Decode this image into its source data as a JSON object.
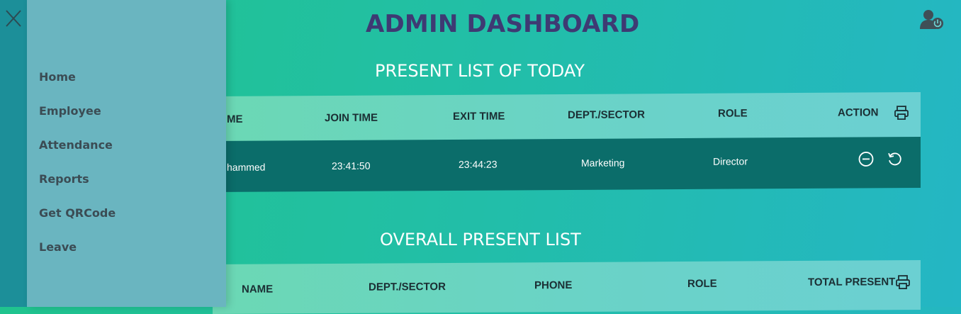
{
  "page": {
    "title": "ADMIN DASHBOARD"
  },
  "nav": {
    "items": [
      {
        "label": "Home"
      },
      {
        "label": "Employee"
      },
      {
        "label": "Attendance"
      },
      {
        "label": "Reports"
      },
      {
        "label": "Get QRCode"
      },
      {
        "label": "Leave"
      }
    ]
  },
  "today": {
    "title": "PRESENT LIST OF TODAY",
    "columns": [
      "ME",
      "JOIN TIME",
      "EXIT TIME",
      "DEPT./SECTOR",
      "ROLE",
      "ACTION"
    ],
    "rows": [
      {
        "name": "hammed",
        "join_time": "23:41:50",
        "exit_time": "23:44:23",
        "dept": "Marketing",
        "role": "Director"
      }
    ]
  },
  "overall": {
    "title": "OVERALL PRESENT LIST",
    "columns": [
      "NAME",
      "DEPT./SECTOR",
      "PHONE",
      "ROLE",
      "TOTAL PRESENT"
    ]
  },
  "icons": {
    "close": "close-icon",
    "user": "user-power-icon",
    "print": "printer-icon",
    "remove": "minus-circle-icon",
    "undo": "undo-icon"
  },
  "colors": {
    "title": "#3e3a73",
    "drawer": "#6ab5c0",
    "row": "#0b6d6a"
  }
}
